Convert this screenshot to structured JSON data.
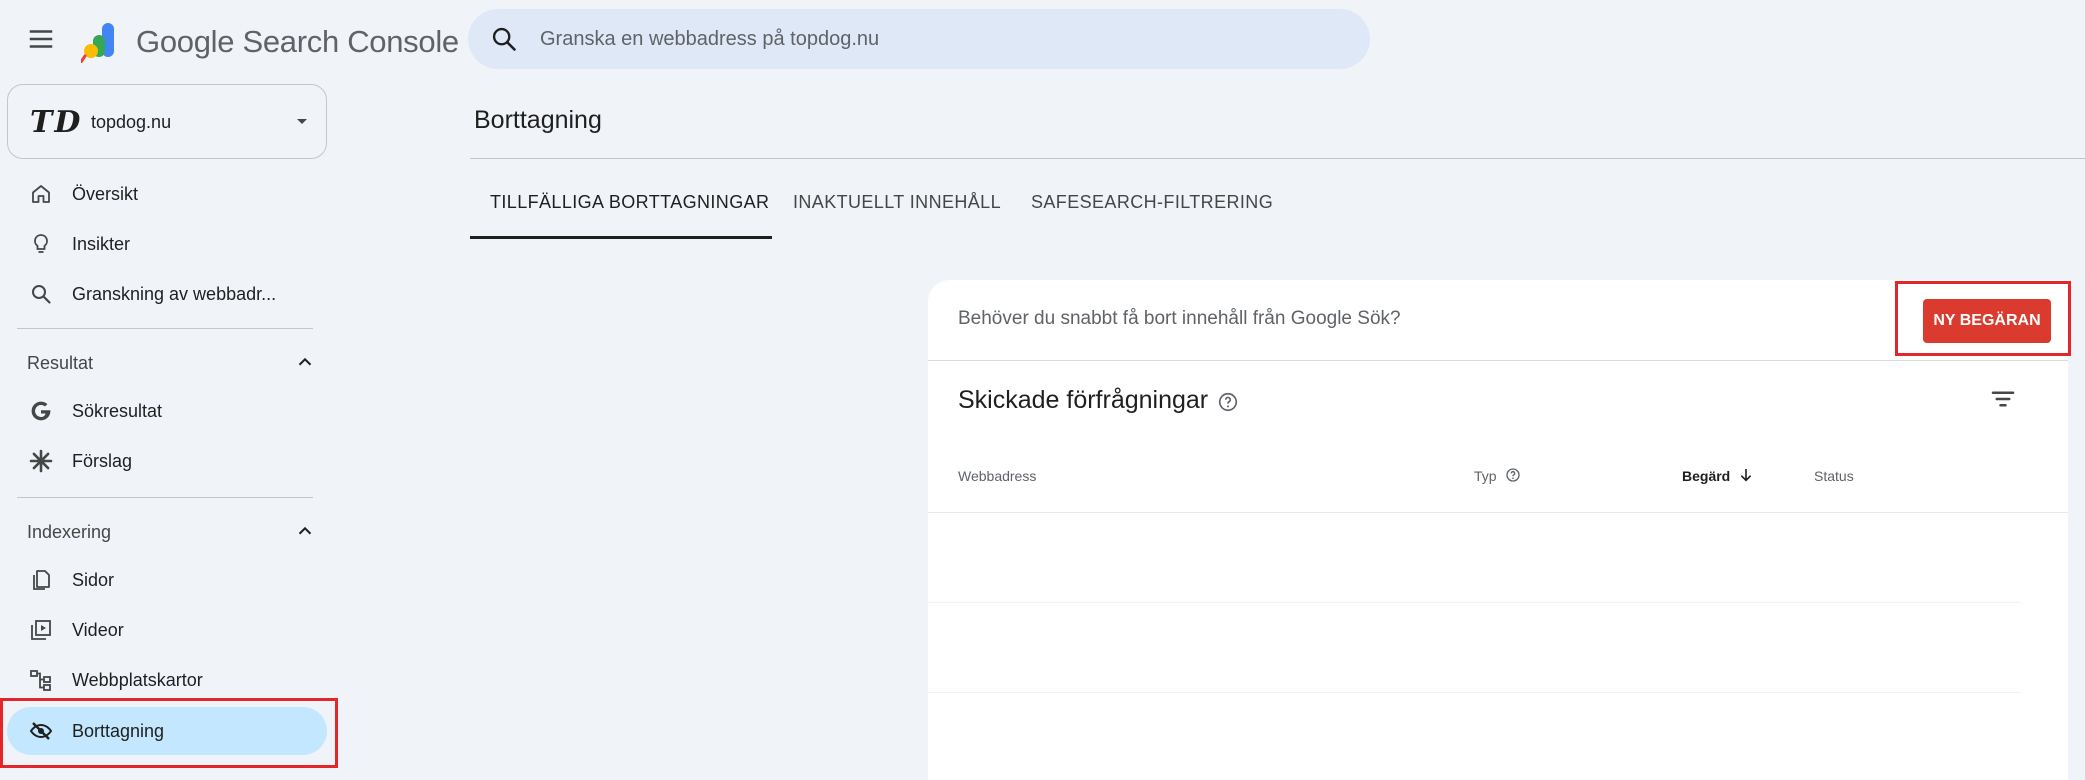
{
  "app": {
    "title": "Google Search Console"
  },
  "search": {
    "placeholder": "Granska en webbadress på topdog.nu"
  },
  "property": {
    "logo_text": "TD",
    "name": "topdog.nu"
  },
  "sidebar": {
    "top_items": [
      {
        "label": "Översikt",
        "icon": "home-icon"
      },
      {
        "label": "Insikter",
        "icon": "lightbulb-icon"
      },
      {
        "label": "Granskning av webbadr...",
        "icon": "search-icon"
      }
    ],
    "sections": [
      {
        "title": "Resultat",
        "items": [
          {
            "label": "Sökresultat",
            "icon": "google-g-icon"
          },
          {
            "label": "Förslag",
            "icon": "asterisk-icon"
          }
        ]
      },
      {
        "title": "Indexering",
        "items": [
          {
            "label": "Sidor",
            "icon": "pages-icon"
          },
          {
            "label": "Videor",
            "icon": "video-icon"
          },
          {
            "label": "Webbplatskartor",
            "icon": "sitemap-icon"
          },
          {
            "label": "Borttagning",
            "icon": "eye-off-icon",
            "active": true
          }
        ]
      }
    ]
  },
  "main": {
    "title": "Borttagning",
    "tabs": [
      {
        "label": "TILLFÄLLIGA BORTTAGNINGAR",
        "active": true
      },
      {
        "label": "INAKTUELLT INNEHÅLL"
      },
      {
        "label": "SAFESEARCH-FILTRERING"
      }
    ],
    "card": {
      "prompt": "Behöver du snabbt få bort innehåll från Google Sök?",
      "button": "NY BEGÄRAN",
      "subtitle": "Skickade förfrågningar",
      "columns": [
        "Webbadress",
        "Typ",
        "Begärd",
        "Status"
      ]
    }
  },
  "colors": {
    "accent_button": "#db3b2f",
    "active_nav": "#c2e7ff",
    "highlight_outline": "#e3262a",
    "background": "#f0f4f9"
  }
}
